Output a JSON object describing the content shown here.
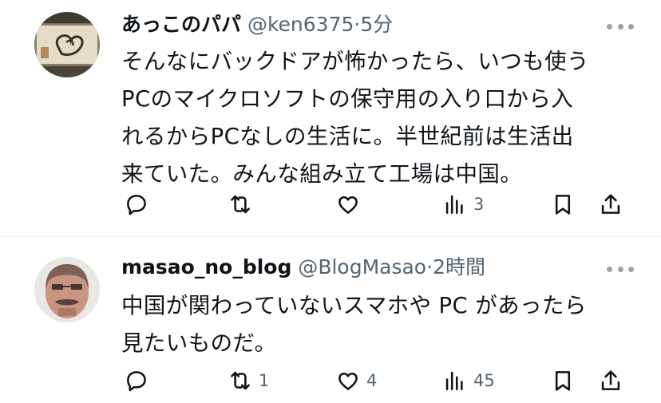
{
  "tweets": [
    {
      "name": "あっこのパパ",
      "handle": "@ken6375",
      "sep": "·",
      "time": "5分",
      "body_lines": [
        "そんなにバックドアが怖かったら、いつも使う",
        "PCのマイクロソフトの保守用の入り口から入",
        "れるからPCなしの生活に。半世紀前は生活出",
        "来ていた。みんな組み立て工場は中国。"
      ],
      "reply_count": "",
      "retweet_count": "",
      "like_count": "",
      "view_count": "3"
    },
    {
      "name": "masao_no_blog",
      "handle": "@BlogMasao",
      "sep": "·",
      "time": "2時間",
      "body_lines": [
        "中国が関わっていないスマホや PC があったら",
        "見たいものだ。"
      ],
      "reply_count": "",
      "retweet_count": "1",
      "like_count": "4",
      "view_count": "45"
    }
  ],
  "icons": {
    "reply": "reply-icon",
    "retweet": "retweet-icon",
    "like": "like-icon",
    "views": "views-icon",
    "bookmark": "bookmark-icon",
    "share": "share-icon",
    "more": "more-icon"
  },
  "colors": {
    "text": "#0f1419",
    "secondary": "#536471",
    "divider": "#eff3f4"
  }
}
